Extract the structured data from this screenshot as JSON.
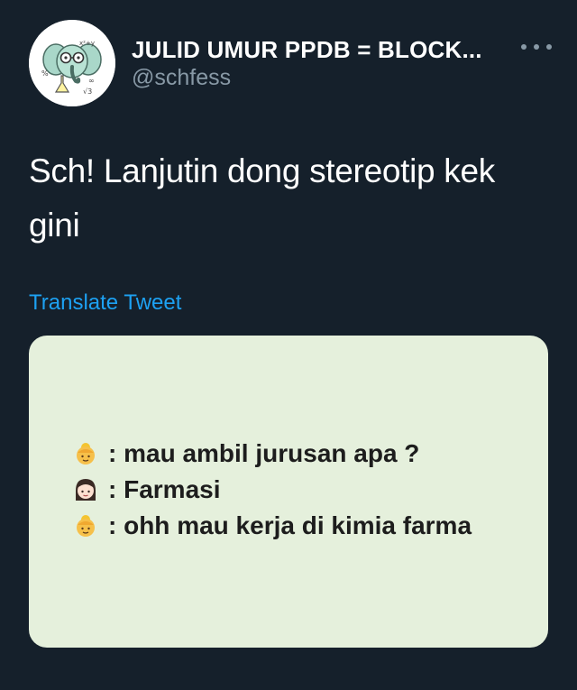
{
  "author": {
    "display_name": "JULID UMUR PPDB = BLOCK...",
    "handle": "@schfess",
    "avatar_icon": "elephant-scientist-avatar"
  },
  "tweet": {
    "text_line1": "Sch! Lanjutin dong stereotip kek",
    "text_line2": "gini",
    "translate_label": "Translate Tweet"
  },
  "media": {
    "lines": [
      {
        "icon": "older-woman-emoji",
        "text": ": mau ambil jurusan apa ?"
      },
      {
        "icon": "girl-emoji",
        "text": ": Farmasi"
      },
      {
        "icon": "older-woman-emoji",
        "text": ": ohh mau kerja di kimia farma"
      }
    ]
  },
  "colors": {
    "background": "#15202b",
    "secondary_text": "#8899a6",
    "link": "#1da1f2",
    "media_background": "#e5f0dc"
  }
}
